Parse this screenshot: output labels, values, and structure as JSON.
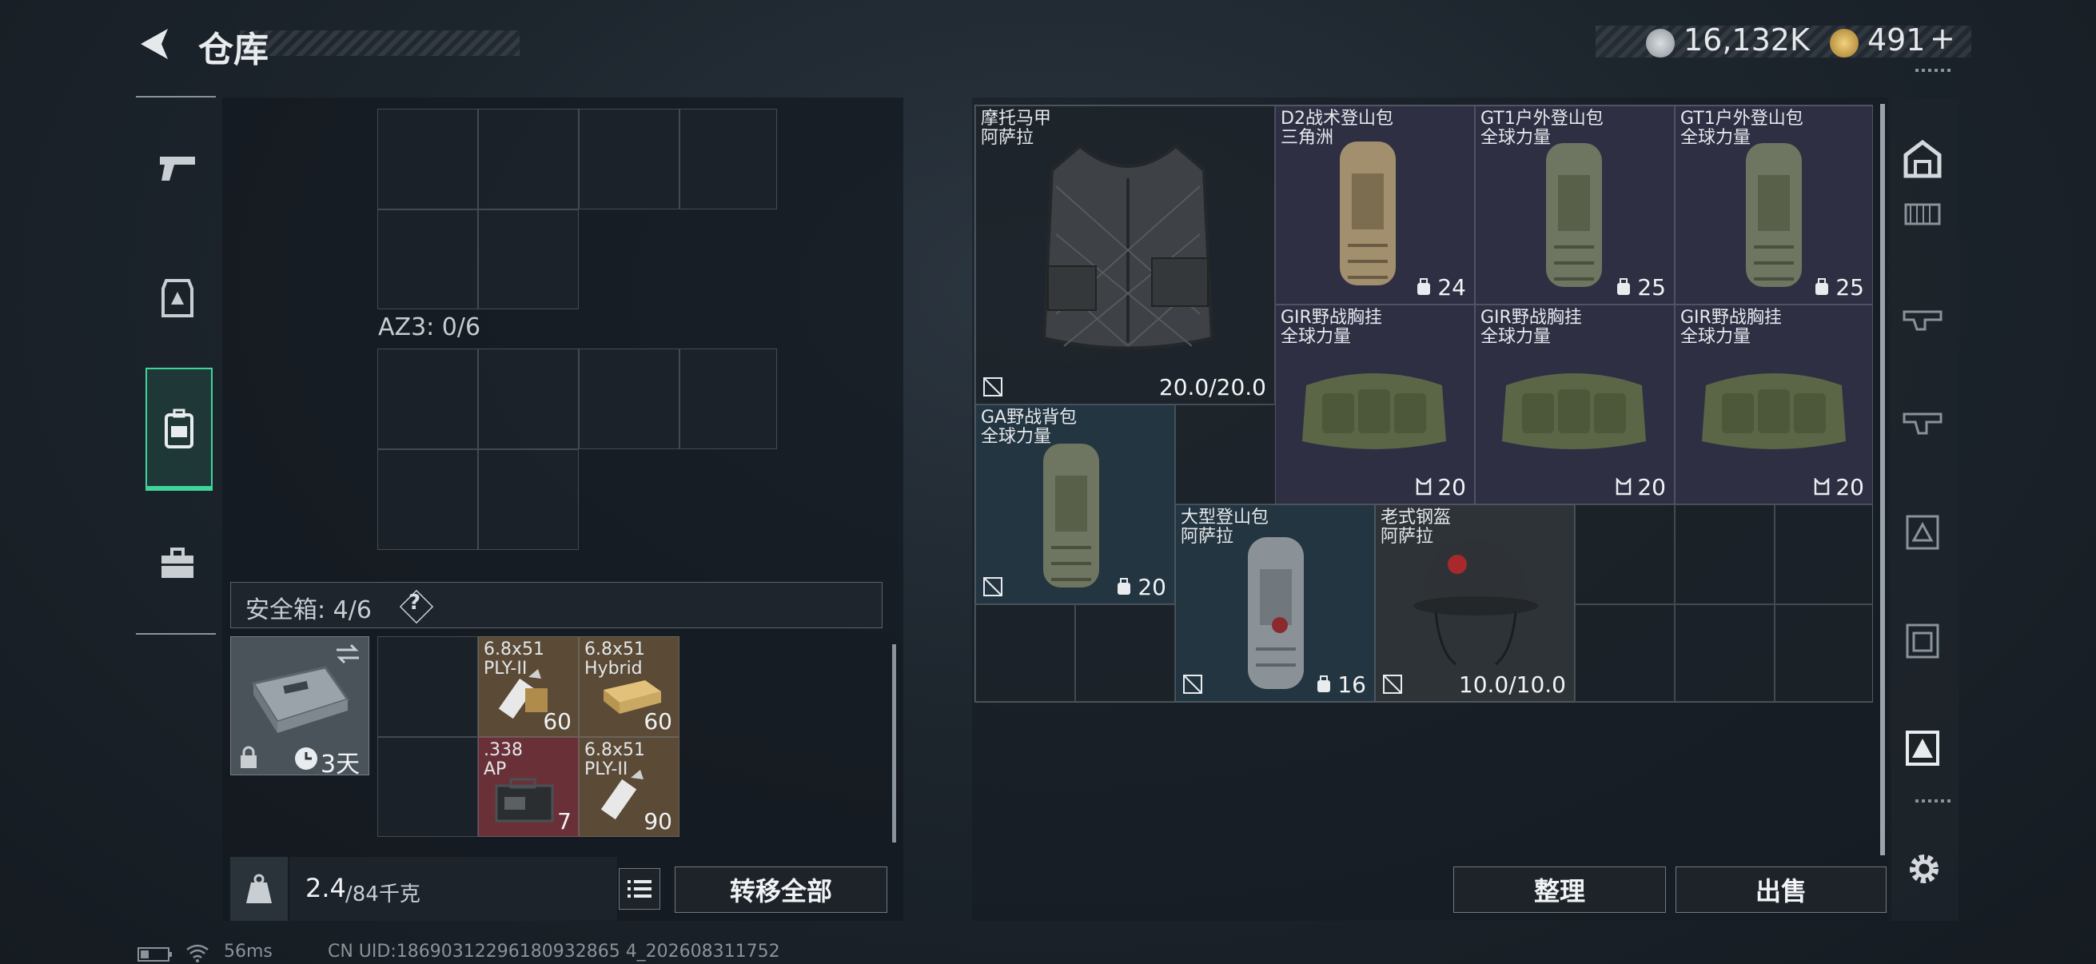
{
  "header": {
    "title": "仓库",
    "currency1": "16,132K",
    "currency2": "491",
    "plus": "+"
  },
  "nav": {
    "items": [
      "weapon-icon",
      "armor-icon",
      "backpack-icon",
      "briefcase-icon"
    ],
    "active": 2
  },
  "left": {
    "az3_label": "AZ3: 0/6",
    "safe_label": "安全箱:  4/6",
    "help": "?",
    "case_timer": "3天",
    "ammo": [
      {
        "line1": "6.8x51",
        "line2": "PLY-II",
        "count": "60"
      },
      {
        "line1": "6.8x51",
        "line2": "Hybrid",
        "count": "60"
      },
      {
        "line1": ".338",
        "line2": "AP",
        "count": "7"
      },
      {
        "line1": "6.8x51",
        "line2": "PLY-II",
        "count": "90"
      }
    ],
    "weight_value": "2.4",
    "weight_max": "/84千克",
    "transfer_all": "转移全部"
  },
  "right": {
    "items": [
      {
        "name1": "摩托马甲",
        "name2": "阿萨拉",
        "value": "20.0/20.0"
      },
      {
        "name1": "D2战术登山包",
        "name2": "三角洲",
        "value": "24"
      },
      {
        "name1": "GT1户外登山包",
        "name2": "全球力量",
        "value": "25"
      },
      {
        "name1": "GT1户外登山包",
        "name2": "全球力量",
        "value": "25"
      },
      {
        "name1": "GIR野战胸挂",
        "name2": "全球力量",
        "value": "20"
      },
      {
        "name1": "GIR野战胸挂",
        "name2": "全球力量",
        "value": "20"
      },
      {
        "name1": "GIR野战胸挂",
        "name2": "全球力量",
        "value": "20"
      },
      {
        "name1": "GA野战背包",
        "name2": "全球力量",
        "value": "20"
      },
      {
        "name1": "大型登山包",
        "name2": "阿萨拉",
        "value": "16"
      },
      {
        "name1": "老式钢盔",
        "name2": "阿萨拉",
        "value": "10.0/10.0"
      }
    ],
    "sort": "整理",
    "sell": "出售"
  },
  "status": {
    "ping": "56ms",
    "uid": "CN UID:18690312296180932865 4_202608311752"
  }
}
